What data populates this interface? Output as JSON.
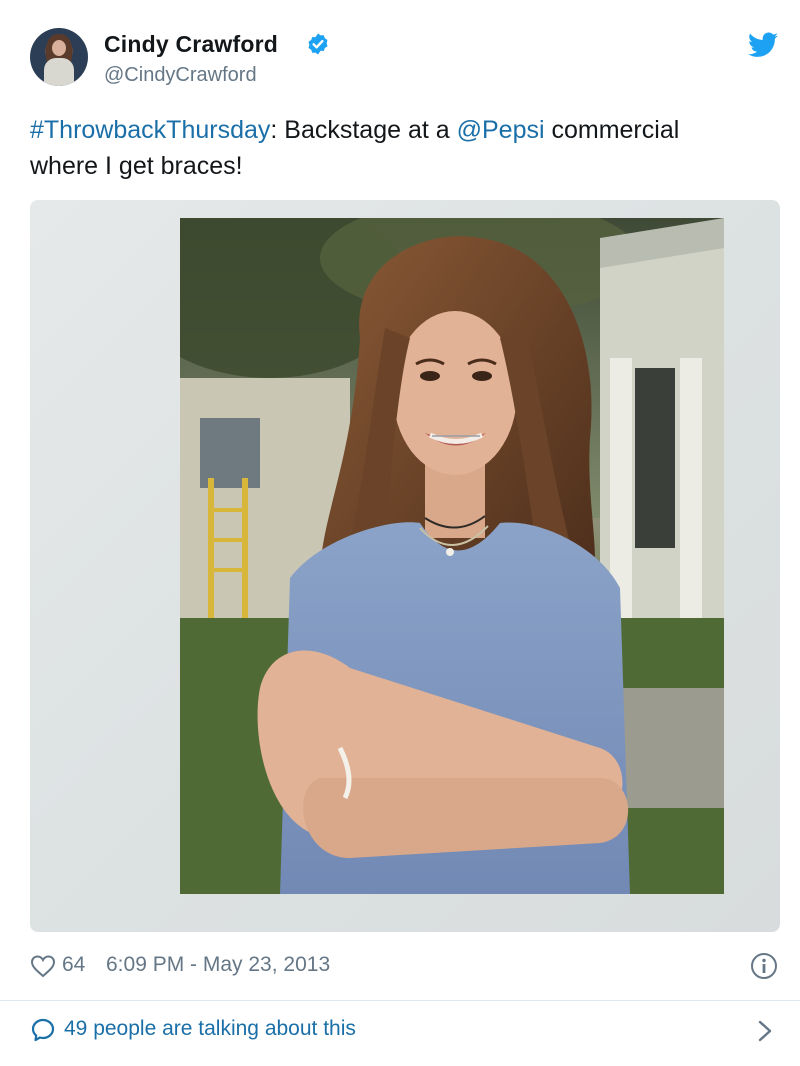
{
  "author": {
    "name": "Cindy Crawford",
    "handle": "@CindyCrawford",
    "verified": true,
    "avatar_icon": "profile-photo"
  },
  "tweet": {
    "hashtag": "#ThrowbackThursday",
    "after_hashtag": ": Backstage at a ",
    "mention": "@Pepsi",
    "after_mention": " commercial",
    "line2": "where I get braces!"
  },
  "media": {
    "type": "photo",
    "icon": "polaroid-photo"
  },
  "stats": {
    "likes": "64",
    "timestamp": "6:09 PM - May 23, 2013"
  },
  "conversation": {
    "label": "49 people are talking about this"
  },
  "colors": {
    "link": "#1b6fa8",
    "twitter_blue": "#1da1f2",
    "muted": "#657786",
    "divider": "#e1e8ed"
  },
  "icons": {
    "verified": "verified-badge-icon",
    "logo": "twitter-bird-icon",
    "like": "heart-icon",
    "info": "info-icon",
    "reply": "comment-icon",
    "more": "chevron-right-icon"
  }
}
